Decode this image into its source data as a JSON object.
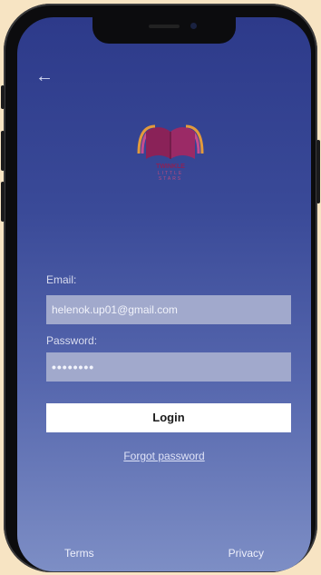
{
  "colors": {
    "background": "#f7e4c3",
    "screen_top": "#2d3a8a",
    "screen_bottom": "#7d8ec5",
    "input_fill": "#a1a9cc",
    "button": "#ffffff"
  },
  "nav": {
    "back_icon": "←"
  },
  "logo": {
    "line1": "TWINKLE",
    "line2": "LITTLE",
    "line3": "STARS"
  },
  "form": {
    "email_label": "Email:",
    "email_value": "helenok.up01@gmail.com",
    "password_label": "Password:",
    "password_value": "••••••••",
    "login_label": "Login",
    "forgot_label": "Forgot password"
  },
  "footer": {
    "terms": "Terms",
    "privacy": "Privacy"
  }
}
